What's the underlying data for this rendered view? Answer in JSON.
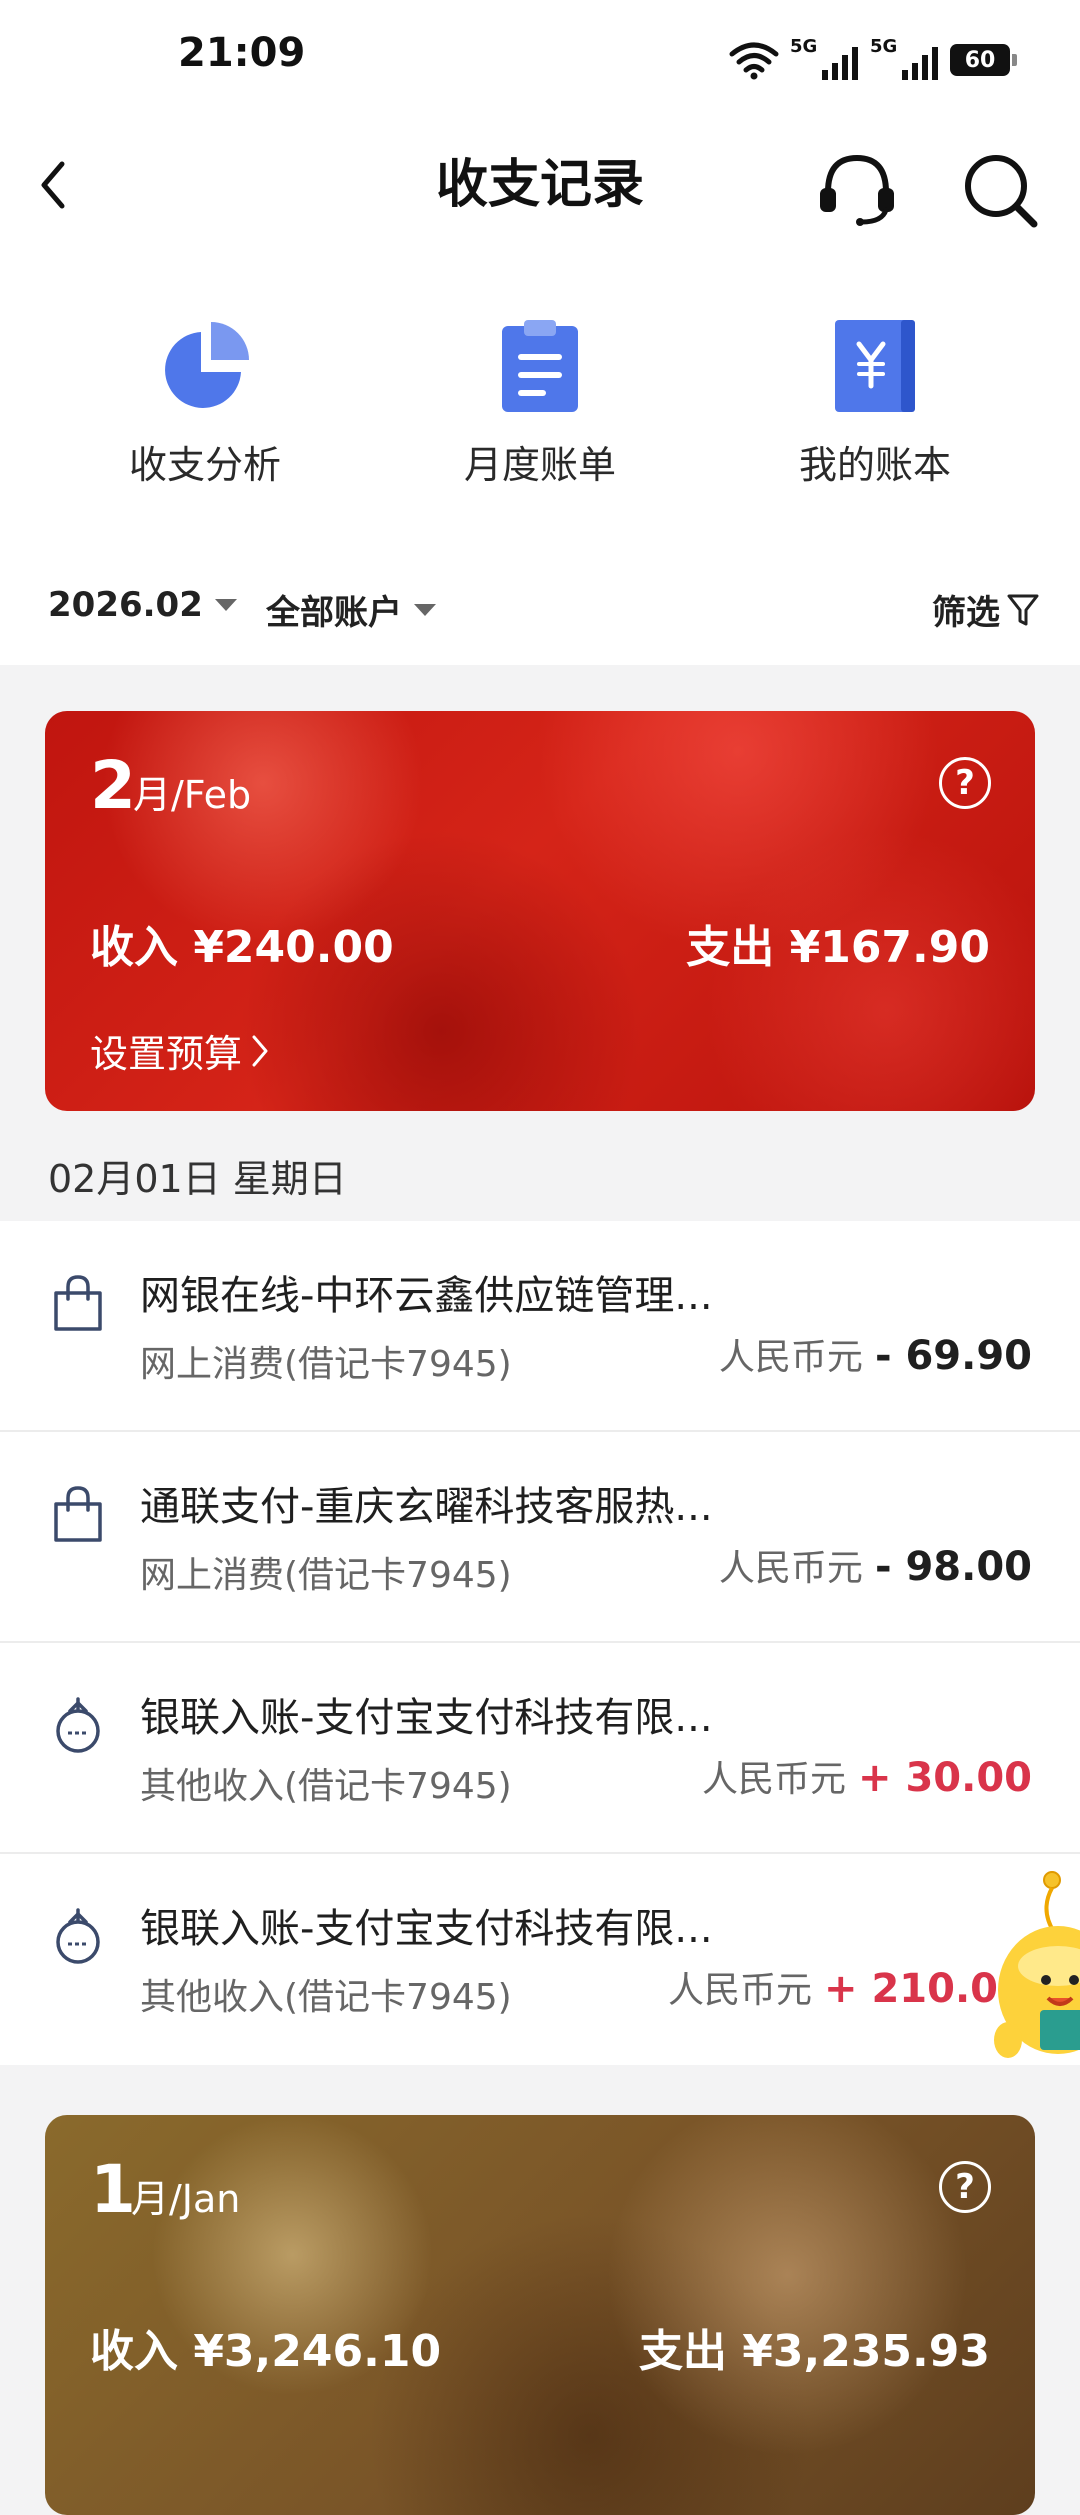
{
  "status_bar": {
    "time": "21:09",
    "network_1": "5G",
    "network_2": "5G",
    "battery": "60"
  },
  "header": {
    "title": "收支记录",
    "back_icon": "chevron-left-icon",
    "service_icon": "headset-icon",
    "search_icon": "search-icon"
  },
  "shortcuts": [
    {
      "label": "收支分析",
      "icon": "pie-chart-icon"
    },
    {
      "label": "月度账单",
      "icon": "clipboard-icon"
    },
    {
      "label": "我的账本",
      "icon": "ledger-yuan-icon"
    }
  ],
  "filters": {
    "date": "2026.02",
    "account": "全部账户",
    "filter_label": "筛选"
  },
  "months": [
    {
      "number": "2",
      "name": "月/Feb",
      "income": "收入 ¥240.00",
      "expense": "支出 ¥167.90",
      "budget": "设置预算"
    },
    {
      "number": "1",
      "name": "月/Jan",
      "income": "收入 ¥3,246.10",
      "expense": "支出 ¥3,235.93"
    }
  ],
  "date_header": "02月01日 星期日",
  "transactions": [
    {
      "title": "网银在线-中环云鑫供应链管理...",
      "subtitle": "网上消费(借记卡7945)",
      "currency": "人民币元",
      "amount": "- 69.90",
      "kind": "out"
    },
    {
      "title": "通联支付-重庆玄曜科技客服热...",
      "subtitle": "网上消费(借记卡7945)",
      "currency": "人民币元",
      "amount": "- 98.00",
      "kind": "out"
    },
    {
      "title": "银联入账-支付宝支付科技有限...",
      "subtitle": "其他收入(借记卡7945)",
      "currency": "人民币元",
      "amount": "+ 30.00",
      "kind": "in"
    },
    {
      "title": "银联入账-支付宝支付科技有限...",
      "subtitle": "其他收入(借记卡7945)",
      "currency": "人民币元",
      "amount": "+ 210.0",
      "kind": "in"
    }
  ],
  "colors": {
    "primary_blue": "#4f77ea",
    "income_red": "#d9344a",
    "feb_card": "#c91a12",
    "jan_card": "#7a5528"
  }
}
